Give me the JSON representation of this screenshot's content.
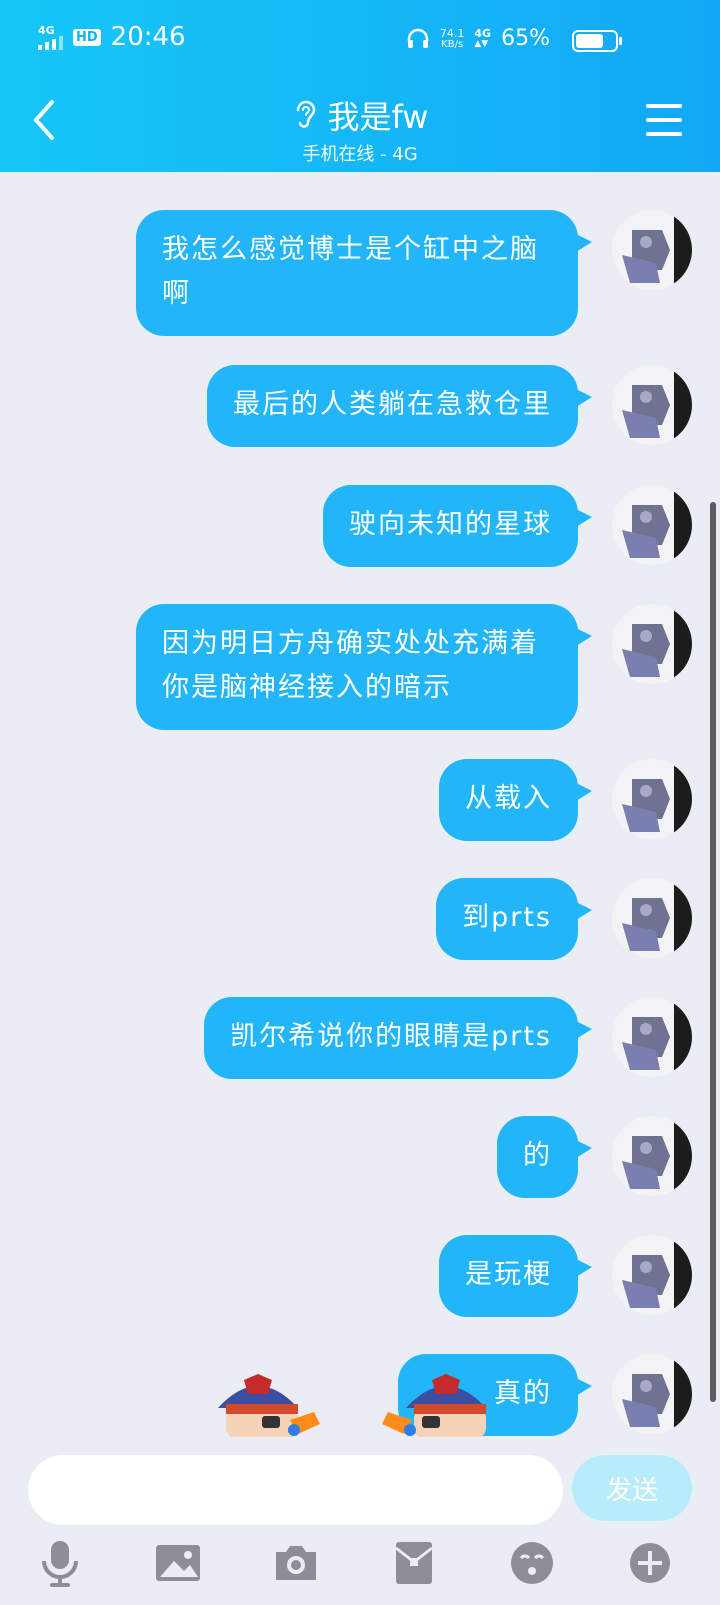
{
  "status_bar": {
    "network_small": "4G",
    "hd": "HD",
    "time": "20:46",
    "speed_value": "74.1",
    "speed_unit": "KB/s",
    "net_type": "4G",
    "battery_pct": "65%"
  },
  "header": {
    "contact_name": "我是fw",
    "contact_status": "手机在线 - 4G"
  },
  "messages": [
    {
      "text": "我怎么感觉博士是个缸中之脑啊"
    },
    {
      "text": "最后的人类躺在急救仓里"
    },
    {
      "text": "驶向未知的星球"
    },
    {
      "text": "因为明日方舟确实处处充满着你是脑神经接入的暗示"
    },
    {
      "text": "从载入"
    },
    {
      "text": "到prts"
    },
    {
      "text": "凯尔希说你的眼睛是prts"
    },
    {
      "text": "的"
    },
    {
      "text": "是玩梗"
    },
    {
      "text": "真的"
    }
  ],
  "input": {
    "value": "",
    "send_label": "发送"
  },
  "toolbar_icons": [
    "microphone-icon",
    "image-icon",
    "camera-icon",
    "red-packet-icon",
    "emoji-icon",
    "plus-icon"
  ],
  "colors": {
    "header_start": "#16c7f7",
    "header_end": "#13a8f5",
    "bubble": "#22b6f8",
    "background": "#eaedf4",
    "send_disabled": "#b7ecfb",
    "icon_gray": "#8c8f96"
  }
}
